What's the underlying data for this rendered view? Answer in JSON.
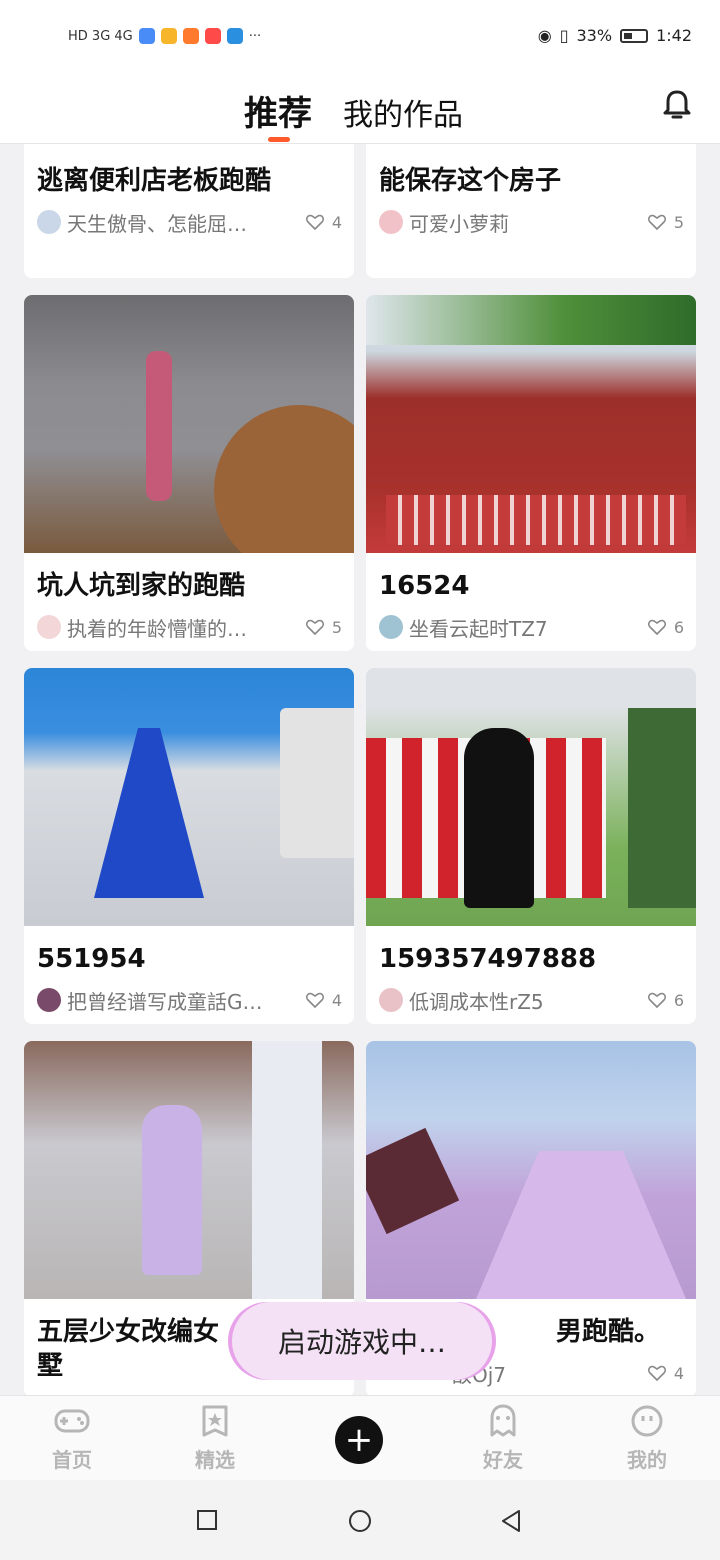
{
  "status_bar": {
    "left_text": "HD 3G 4G",
    "battery": "33%",
    "time": "1:42"
  },
  "header": {
    "tab_active": "推荐",
    "tab_inactive": "我的作品"
  },
  "cards": [
    {
      "title": "逃离便利店老板跑酷",
      "author": "天生傲骨、怎能屈…",
      "likes": "4"
    },
    {
      "title": "能保存这个房子",
      "author": "可爱小萝莉",
      "likes": "5"
    },
    {
      "title": "坑人坑到家的跑酷",
      "author": "执着的年龄懵懂的…",
      "likes": "5"
    },
    {
      "title": "16524",
      "author": "坐看云起时TZ7",
      "likes": "6"
    },
    {
      "title": "551954",
      "author": "把曾经谱写成童話G…",
      "likes": "4"
    },
    {
      "title": "159357497888",
      "author": "低调成本性rZ5",
      "likes": "6"
    },
    {
      "title": "五层少女改编女\n墅",
      "author": "",
      "likes": ""
    },
    {
      "title": "男跑酷。",
      "author": "敌Oj7",
      "likes": "4"
    }
  ],
  "toast": "启动游戏中…",
  "bottom_nav": {
    "home": "首页",
    "featured": "精选",
    "friends": "好友",
    "mine": "我的"
  },
  "colors": {
    "accent": "#ff5a2c",
    "toast_bg": "#f4e1f5"
  }
}
